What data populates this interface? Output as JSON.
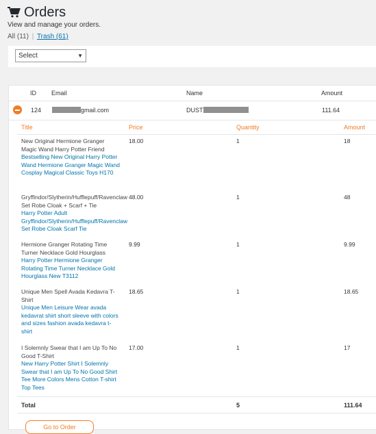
{
  "header": {
    "title": "Orders",
    "subtitle": "View and manage your orders.",
    "icon": "cart-icon"
  },
  "filters": {
    "all_label": "All (11)",
    "separator": "|",
    "trash_label": "Trash (61)"
  },
  "toolbar": {
    "bulk_select": "Select"
  },
  "orders_table": {
    "columns": {
      "id": "ID",
      "email": "Email",
      "name": "Name",
      "amount": "Amount"
    },
    "order": {
      "id": "124",
      "email_suffix": "gmail.com",
      "name_prefix": "DUST",
      "amount": "111.64"
    }
  },
  "items_table": {
    "columns": {
      "title": "Title",
      "price": "Price",
      "quantity": "Quantity",
      "amount": "Amount"
    },
    "items": [
      {
        "title": "New Original Hermione Granger Magic Wand Harry Potter Friend",
        "link": "Bestselling New Original Harry Potter Wand Hermione Granger Magic Wand Cosplay Magical Classic Toys H170",
        "price": "18.00",
        "quantity": "1",
        "amount": "18"
      },
      {
        "title": "Gryffindor/Slytherin/Hufflepuff/Ravenclaw Set Robe Cloak + Scarf + Tie",
        "link": "Harry Potter Adult Gryffindor/Slytherin/Hufflepuff/Ravenclaw Set Robe Cloak Scarf Tie",
        "price": "48.00",
        "quantity": "1",
        "amount": "48"
      },
      {
        "title": "Hermione Granger Rotating Time Turner Necklace Gold Hourglass",
        "link": "Harry Potter Hermione Granger Rotating Time Turner Necklace Gold Hourglass New T3112",
        "price": "9.99",
        "quantity": "1",
        "amount": "9.99"
      },
      {
        "title": "Unique Men Spell Avada Kedavra T-Shirt",
        "link": "Unique Men Leisure Wear avada kedavrat shirt short sleeve with colors and sizes fashion avada kedavra t-shirt",
        "price": "18.65",
        "quantity": "1",
        "amount": "18.65"
      },
      {
        "title": "I Solemnly Swear that I am Up To No Good T-Shirt",
        "link": "New Harry Potter Shirt I Solemnly Swear that I am Up To No Good Shirt Tee More Colors Mens Cotton T-shirt Top Tees",
        "price": "17.00",
        "quantity": "1",
        "amount": "17"
      }
    ],
    "total": {
      "label": "Total",
      "quantity": "5",
      "amount": "111.64"
    }
  },
  "actions": {
    "go_to_order": "Go to Order"
  },
  "colors": {
    "accent": "#f07c25",
    "link": "#0073aa"
  }
}
